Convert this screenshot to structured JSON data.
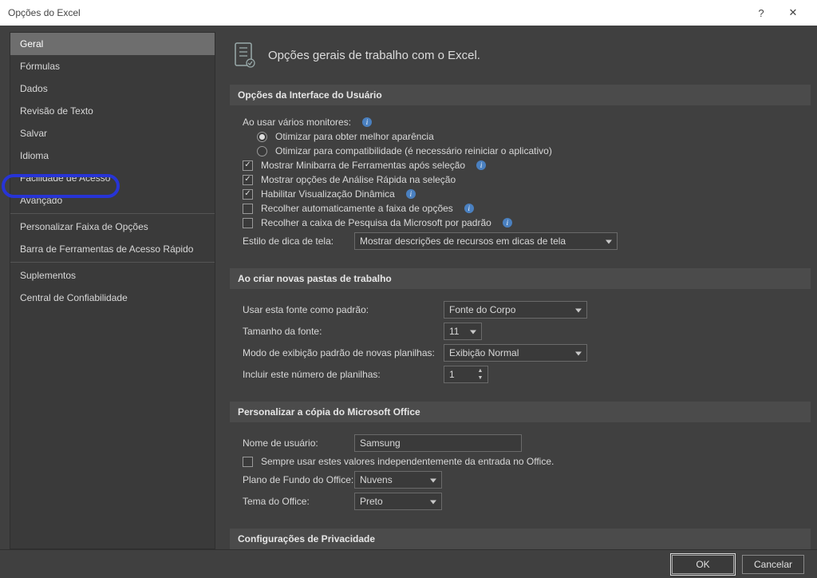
{
  "titlebar": {
    "title": "Opções do Excel",
    "help": "?",
    "close": "✕"
  },
  "sidebar": {
    "items": [
      {
        "label": "Geral"
      },
      {
        "label": "Fórmulas"
      },
      {
        "label": "Dados"
      },
      {
        "label": "Revisão de Texto"
      },
      {
        "label": "Salvar"
      },
      {
        "label": "Idioma"
      },
      {
        "label": "Facilidade de Acesso"
      },
      {
        "label": "Avançado"
      },
      {
        "label": "Personalizar Faixa de Opções"
      },
      {
        "label": "Barra de Ferramentas de Acesso Rápido"
      },
      {
        "label": "Suplementos"
      },
      {
        "label": "Central de Confiabilidade"
      }
    ],
    "selected_index": 0
  },
  "main": {
    "header": "Opções gerais de trabalho com o Excel.",
    "section_ui": {
      "title": "Opções da Interface do Usuário",
      "multi_monitor_label": "Ao usar vários monitores:",
      "radio_appearance": "Otimizar para obter melhor aparência",
      "radio_compat": "Otimizar para compatibilidade (é necessário reiniciar o aplicativo)",
      "chk_minibar": "Mostrar Minibarra de Ferramentas após seleção",
      "chk_quick": "Mostrar opções de Análise Rápida na seleção",
      "chk_live": "Habilitar Visualização Dinâmica",
      "chk_collapse_ribbon": "Recolher automaticamente a faixa de opções",
      "chk_collapse_search": "Recolher a caixa de Pesquisa da Microsoft por padrão",
      "screentip_label": "Estilo de dica de tela:",
      "screentip_value": "Mostrar descrições de recursos em dicas de tela"
    },
    "section_wb": {
      "title": "Ao criar novas pastas de trabalho",
      "font_label": "Usar esta fonte como padrão:",
      "font_value": "Fonte do Corpo",
      "size_label": "Tamanho da fonte:",
      "size_value": "11",
      "view_label": "Modo de exibição padrão de novas planilhas:",
      "view_value": "Exibição Normal",
      "sheets_label": "Incluir este número de planilhas:",
      "sheets_value": "1"
    },
    "section_office": {
      "title": "Personalizar a cópia do Microsoft Office",
      "user_label": "Nome de usuário:",
      "user_value": "Samsung",
      "chk_always": "Sempre usar estes valores independentemente da entrada no Office.",
      "bg_label": "Plano de Fundo do Office:",
      "bg_value": "Nuvens",
      "theme_label": "Tema do Office:",
      "theme_value": "Preto"
    },
    "section_privacy": {
      "title": "Configurações de Privacidade"
    }
  },
  "footer": {
    "ok": "OK",
    "cancel": "Cancelar"
  }
}
